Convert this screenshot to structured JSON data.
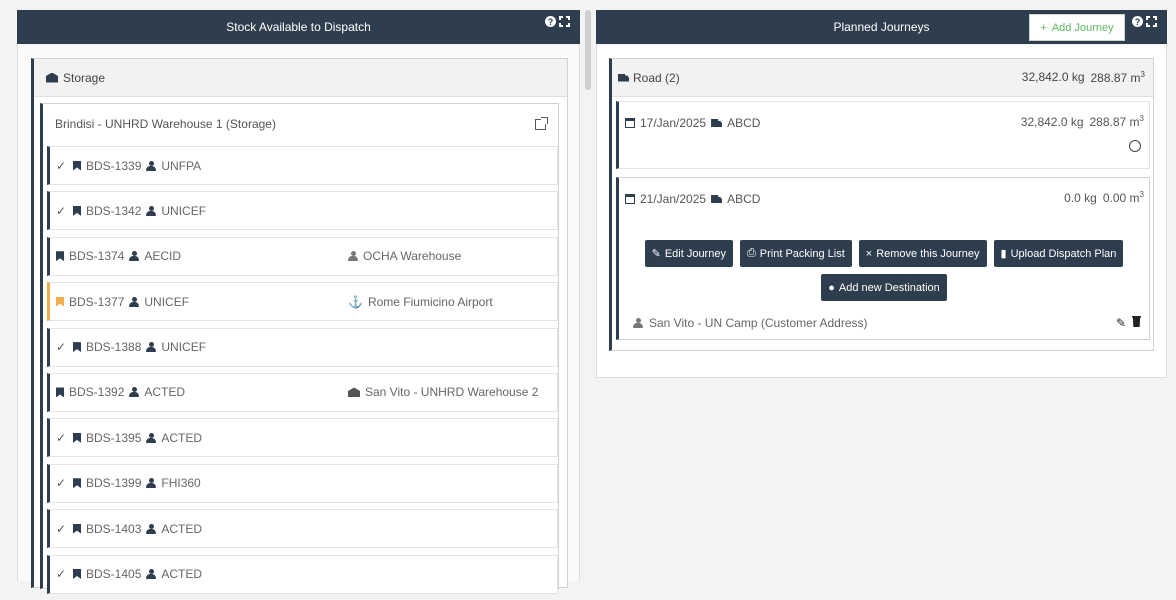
{
  "left_panel": {
    "title": "Stock Available to Dispatch",
    "storage_label": "Storage",
    "warehouse": "Brindisi - UNHRD Warehouse 1 (Storage)",
    "rows": [
      {
        "checked": true,
        "code": "BDS-1339",
        "org": "UNFPA",
        "dest": "",
        "dest_icon": "",
        "highlight": false
      },
      {
        "checked": true,
        "code": "BDS-1342",
        "org": "UNICEF",
        "dest": "",
        "dest_icon": "",
        "highlight": false
      },
      {
        "checked": false,
        "code": "BDS-1374",
        "org": "AECID",
        "dest": "OCHA Warehouse",
        "dest_icon": "person-icon",
        "highlight": false
      },
      {
        "checked": false,
        "code": "BDS-1377",
        "org": "UNICEF",
        "dest": "Rome Fiumicino Airport",
        "dest_icon": "anchor-icon",
        "highlight": true
      },
      {
        "checked": true,
        "code": "BDS-1388",
        "org": "UNICEF",
        "dest": "",
        "dest_icon": "",
        "highlight": false
      },
      {
        "checked": false,
        "code": "BDS-1392",
        "org": "ACTED",
        "dest": "San Vito - UNHRD Warehouse 2",
        "dest_icon": "warehouse-icon",
        "highlight": false
      },
      {
        "checked": true,
        "code": "BDS-1395",
        "org": "ACTED",
        "dest": "",
        "dest_icon": "",
        "highlight": false
      },
      {
        "checked": true,
        "code": "BDS-1399",
        "org": "FHI360",
        "dest": "",
        "dest_icon": "",
        "highlight": false
      },
      {
        "checked": true,
        "code": "BDS-1403",
        "org": "ACTED",
        "dest": "",
        "dest_icon": "",
        "highlight": false
      },
      {
        "checked": true,
        "code": "BDS-1405",
        "org": "ACTED",
        "dest": "",
        "dest_icon": "",
        "highlight": false
      }
    ]
  },
  "right_panel": {
    "title": "Planned Journeys",
    "add_journey": "Add Journey",
    "road_label": "Road (2)",
    "road_weight": "32,842.0 kg",
    "road_volume": "288.87 m",
    "journeys": [
      {
        "date": "17/Jan/2025",
        "vehicle": "ABCD",
        "weight": "32,842.0 kg",
        "volume": "288.87 m"
      },
      {
        "date": "21/Jan/2025",
        "vehicle": "ABCD",
        "weight": "0.0 kg",
        "volume": "0.00 m"
      }
    ],
    "buttons": {
      "edit": "Edit Journey",
      "print": "Print Packing List",
      "remove": "Remove this Journey",
      "upload": "Upload Dispatch Plan",
      "add_dest": "Add new Destination"
    },
    "address": "San Vito - UN Camp (Customer Address)"
  }
}
